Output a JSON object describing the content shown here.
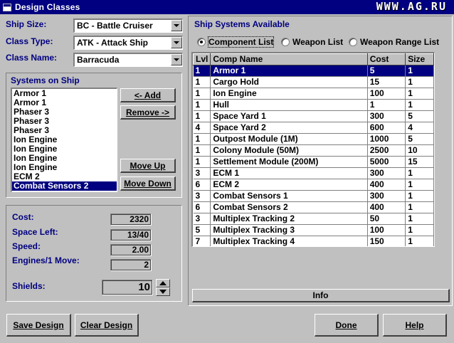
{
  "window": {
    "title": "Design Classes",
    "watermark": "WWW.AG.RU"
  },
  "left": {
    "ship_size": {
      "label": "Ship Size:",
      "value": "BC - Battle Cruiser"
    },
    "class_type": {
      "label": "Class Type:",
      "value": "ATK - Attack Ship"
    },
    "class_name": {
      "label": "Class Name:",
      "value": "Barracuda"
    },
    "systems_on_ship": {
      "label": "Systems on Ship",
      "items": [
        "Armor 1",
        "Armor 1",
        "Phaser 3",
        "Phaser 3",
        "Phaser 3",
        "Ion Engine",
        "Ion Engine",
        "Ion Engine",
        "Ion Engine",
        "ECM 2",
        "Combat Sensors 2"
      ],
      "selected_index": 10
    },
    "buttons": {
      "add": "<- Add",
      "remove": "Remove ->",
      "move_up": "Move Up",
      "move_down": "Move Down"
    },
    "stats": {
      "cost": {
        "label": "Cost:",
        "value": "2320"
      },
      "space_left": {
        "label": "Space Left:",
        "value": "13/40"
      },
      "speed": {
        "label": "Speed:",
        "value": "2.00"
      },
      "engines": {
        "label": "Engines/1 Move:",
        "value": "2"
      },
      "shields": {
        "label": "Shields:",
        "value": "10"
      }
    }
  },
  "right": {
    "title": "Ship Systems Available",
    "radios": [
      {
        "label": "Component List",
        "checked": true
      },
      {
        "label": "Weapon List",
        "checked": false
      },
      {
        "label": "Weapon Range List",
        "checked": false
      }
    ],
    "table": {
      "headers": [
        "Lvl",
        "Comp Name",
        "Cost",
        "Size"
      ],
      "rows": [
        [
          "1",
          "Armor 1",
          "5",
          "1"
        ],
        [
          "1",
          "Cargo Hold",
          "15",
          "1"
        ],
        [
          "1",
          "Ion Engine",
          "100",
          "1"
        ],
        [
          "1",
          "Hull",
          "1",
          "1"
        ],
        [
          "1",
          "Space Yard 1",
          "300",
          "5"
        ],
        [
          "4",
          "Space Yard 2",
          "600",
          "4"
        ],
        [
          "1",
          "Outpost Module (1M)",
          "1000",
          "5"
        ],
        [
          "1",
          "Colony Module (50M)",
          "2500",
          "10"
        ],
        [
          "1",
          "Settlement Module (200M)",
          "5000",
          "15"
        ],
        [
          "3",
          "ECM 1",
          "300",
          "1"
        ],
        [
          "6",
          "ECM 2",
          "400",
          "1"
        ],
        [
          "3",
          "Combat Sensors 1",
          "300",
          "1"
        ],
        [
          "6",
          "Combat Sensors 2",
          "400",
          "1"
        ],
        [
          "3",
          "Multiplex Tracking 2",
          "50",
          "1"
        ],
        [
          "5",
          "Multiplex Tracking 3",
          "100",
          "1"
        ],
        [
          "7",
          "Multiplex Tracking 4",
          "150",
          "1"
        ]
      ],
      "selected_index": 0
    },
    "info_button": "Info"
  },
  "bottom": {
    "save": "Save Design",
    "clear": "Clear Design",
    "done": "Done",
    "help": "Help"
  }
}
